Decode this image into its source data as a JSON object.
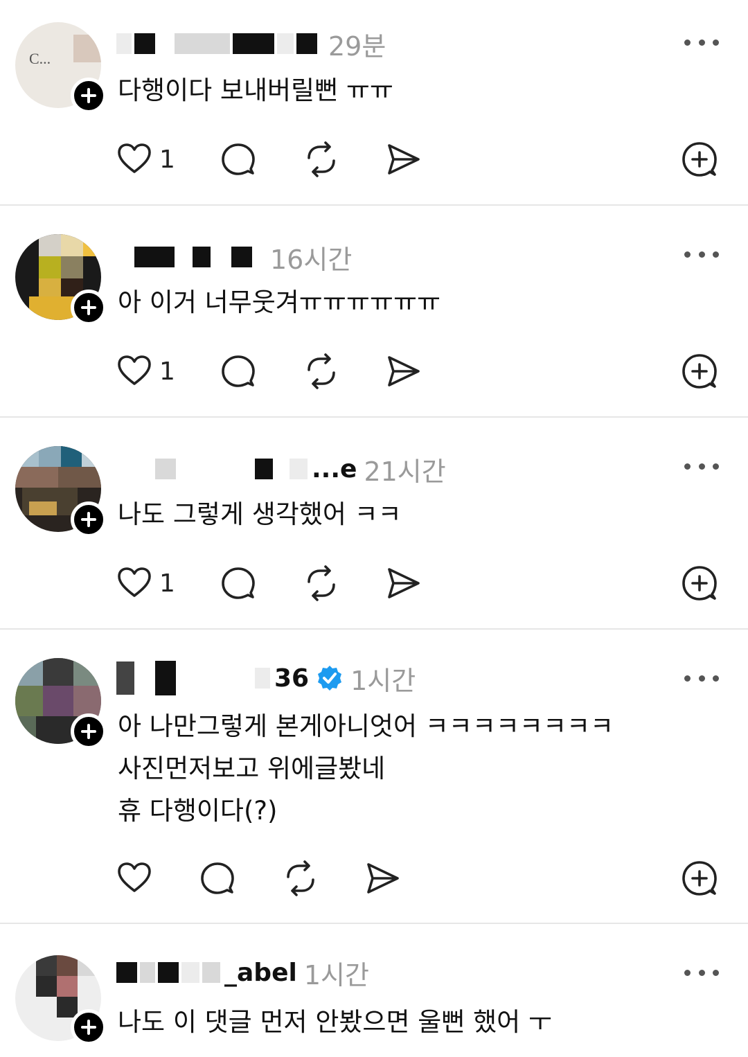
{
  "posts": [
    {
      "username_tail": "",
      "time": "29분",
      "text": "다행이다 보내버릴뻔 ㅠㅠ",
      "like_count": "1",
      "verified": false
    },
    {
      "username_tail": "",
      "time": "16시간",
      "text": "아 이거 너무웃겨ㅠㅠㅠㅠㅠㅠ",
      "like_count": "1",
      "verified": false
    },
    {
      "username_tail": "...e",
      "time": "21시간",
      "text": "나도 그렇게 생각했어 ㅋㅋ",
      "like_count": "1",
      "verified": false
    },
    {
      "username_tail": "36",
      "time": "1시간",
      "text": "아 나만그렇게 본게아니엇어 ㅋㅋㅋㅋㅋㅋㅋㅋ\n사진먼저보고 위에글봤네\n휴 다행이다(?)",
      "like_count": "",
      "verified": true
    },
    {
      "username_tail": "_abel",
      "time": "1시간",
      "text": "나도 이 댓글 먼저 안봤으면 울뻔 했어 ㅜ",
      "like_count": "",
      "verified": false
    }
  ],
  "icons": {
    "like": "heart-icon",
    "reply": "comment-icon",
    "repost": "repost-icon",
    "share": "send-icon",
    "more": "more-icon",
    "follow": "plus-icon",
    "add": "add-circle-icon",
    "verified": "verified-badge-icon"
  },
  "colors": {
    "verified": "#1d9bf0",
    "time": "#9a9a9a",
    "divider": "#e6e6e6"
  }
}
